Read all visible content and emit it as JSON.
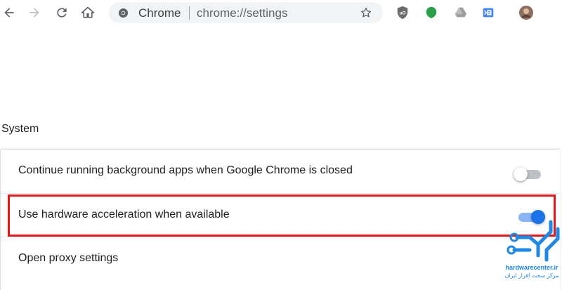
{
  "toolbar": {
    "icons": [
      "back-arrow-icon",
      "forward-arrow-icon",
      "reload-icon",
      "home-icon"
    ],
    "omnibox": {
      "site_chip": "Chrome",
      "url": "chrome://settings",
      "bookmark_icon": "star-icon"
    },
    "extensions": [
      "ublock-origin-icon",
      "green-leaf-icon",
      "google-drive-icon",
      "docs-offline-icon",
      "profile-avatar"
    ]
  },
  "settings": {
    "section_title": "System",
    "rows": [
      {
        "label": "Continue running background apps when Google Chrome is closed",
        "control": "toggle",
        "enabled": false
      },
      {
        "label": "Use hardware acceleration when available",
        "control": "toggle",
        "enabled": true,
        "highlighted": true
      },
      {
        "label": "Open proxy settings",
        "control": "link"
      }
    ]
  },
  "colors": {
    "accent": "#1a73e8",
    "accent_track": "#8ab4f8",
    "highlight_box": "#e3161b",
    "text": "#202124"
  },
  "watermark": {
    "latin": "hardwarecenter.ir",
    "farsi": "مرکز سخت افزار ایران"
  }
}
